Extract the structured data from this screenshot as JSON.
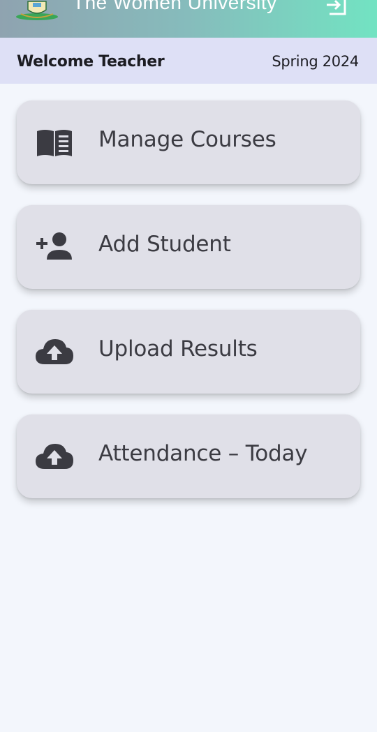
{
  "header": {
    "title": "The Women University",
    "logo_icon": "university-crest-icon",
    "logout_icon": "logout-icon",
    "gradient_start": "#8fa3b0",
    "gradient_end": "#72e3c2"
  },
  "welcome": {
    "greeting": "Welcome Teacher",
    "term": "Spring 2024",
    "background": "#dee0f6"
  },
  "menu": {
    "items": [
      {
        "label": "Manage Courses",
        "icon": "menu-book-icon"
      },
      {
        "label": "Add Student",
        "icon": "person-add-icon"
      },
      {
        "label": "Upload Results",
        "icon": "cloud-upload-icon"
      },
      {
        "label": "Attendance – Today",
        "icon": "cloud-upload-icon"
      }
    ]
  },
  "colors": {
    "page_background": "#f3f6fc",
    "card_background": "#e0e0e8",
    "icon_color": "#3b3b42"
  }
}
